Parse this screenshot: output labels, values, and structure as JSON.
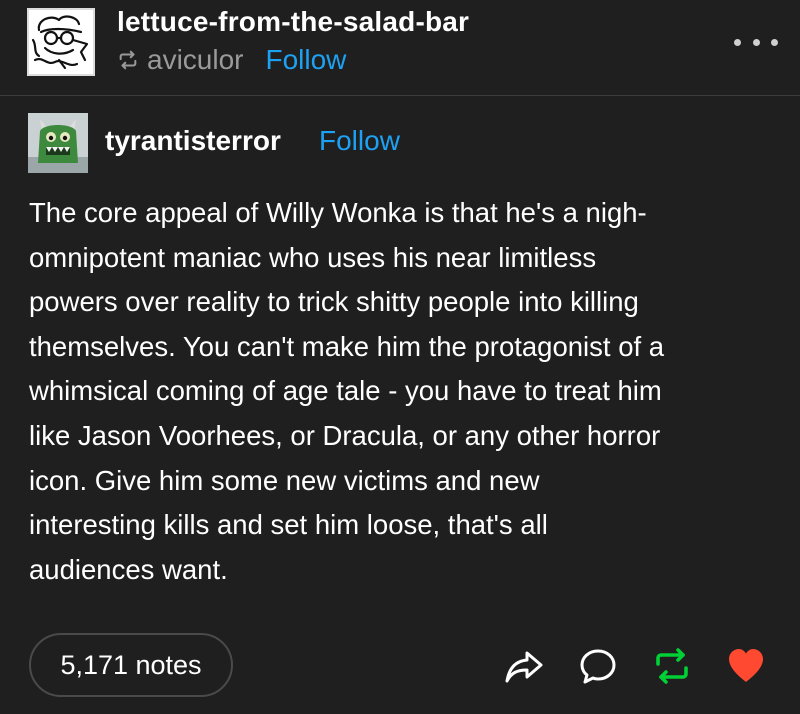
{
  "header": {
    "blog_name": "lettuce-from-the-salad-bar",
    "reblogged_from": "aviculor",
    "follow_label": "Follow"
  },
  "post": {
    "author": "tyrantisterror",
    "follow_label": "Follow",
    "body_lines": [
      "The core appeal of Willy Wonka is that he's a nigh-",
      "omnipotent maniac who uses his near limitless",
      "powers over reality to trick shitty people into killing",
      "themselves.  You can't make him the protagonist of a",
      "whimsical coming of age tale - you have to treat him",
      "like Jason Voorhees, or Dracula, or any other horror",
      "icon.  Give him some new victims and new",
      "interesting kills and set him loose, that's all",
      "audiences want."
    ]
  },
  "footer": {
    "notes_label": "5,171 notes"
  },
  "icons": {
    "share": "share-icon",
    "reply": "reply-icon",
    "reblog": "reblog-icon",
    "like": "heart-icon"
  },
  "colors": {
    "background": "#1f1f1f",
    "link": "#1da1f2",
    "reblog_active": "#00cf35",
    "like_active": "#ff4930"
  }
}
